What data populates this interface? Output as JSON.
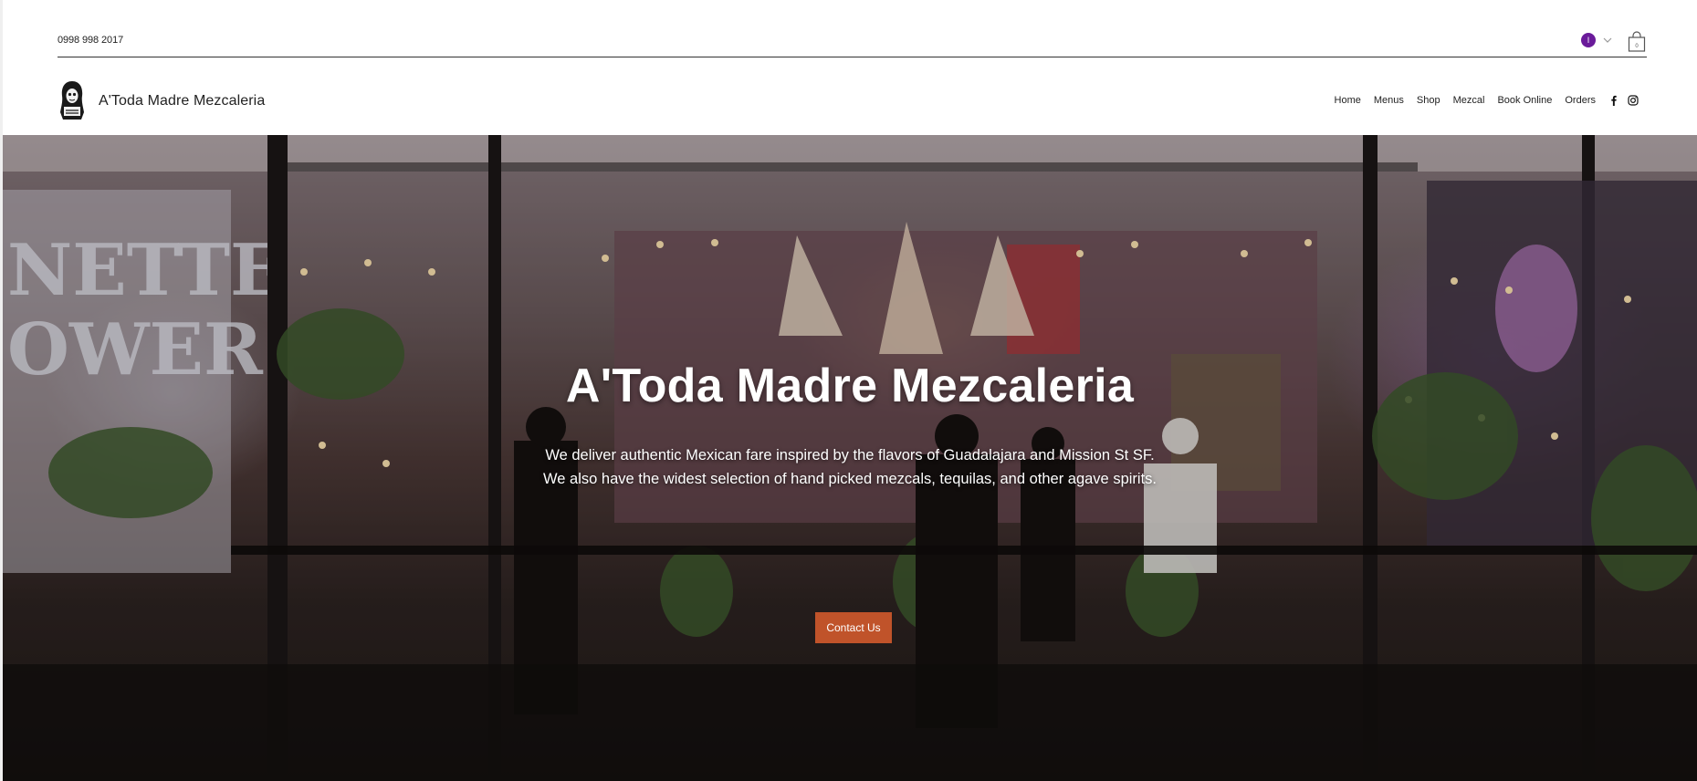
{
  "topbar": {
    "phone": "0998 998 2017",
    "avatar_initial": "I"
  },
  "header": {
    "site_name": "A'Toda Madre Mezcaleria",
    "nav": [
      "Home",
      "Menus",
      "Shop",
      "Mezcal",
      "Book Online",
      "Orders"
    ],
    "social": [
      "facebook-icon",
      "instagram-icon"
    ]
  },
  "hero": {
    "title": "A'Toda Madre Mezcaleria",
    "subtitle_line1": "We deliver authentic Mexican fare inspired by the flavors of Guadalajara and Mission St SF.",
    "subtitle_line2": "We also have the widest selection of hand picked mezcals, tequilas, and other agave spirits.",
    "cta_label": "Contact Us"
  },
  "colors": {
    "accent": "#c0532a",
    "avatar": "#6a1b9a"
  }
}
